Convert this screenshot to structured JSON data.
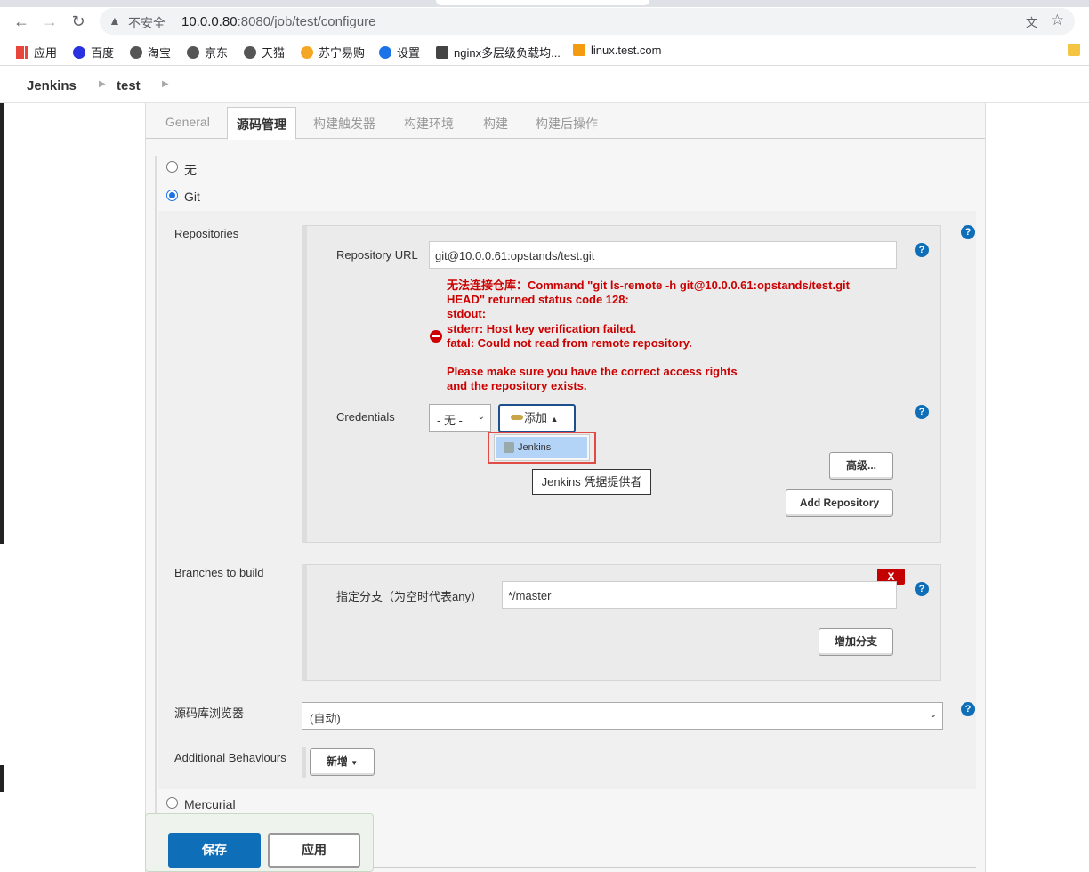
{
  "browser": {
    "back_icon": "arrow-left-icon",
    "forward_icon": "arrow-right-icon",
    "reload_icon": "reload-icon",
    "security_warning": "不安全",
    "url_host": "10.0.0.80",
    "url_path": ":8080/job/test/configure"
  },
  "bookmarks": [
    {
      "label": "应用",
      "icon": "apps-grid-icon"
    },
    {
      "label": "百度",
      "icon": "baidu-paw-icon"
    },
    {
      "label": "淘宝",
      "icon": "globe-icon"
    },
    {
      "label": "京东",
      "icon": "globe-icon"
    },
    {
      "label": "天猫",
      "icon": "globe-icon"
    },
    {
      "label": "苏宁易购",
      "icon": "suning-icon"
    },
    {
      "label": "设置",
      "icon": "gear-icon"
    },
    {
      "label": "nginx多层级负载均...",
      "icon": "nginx-icon"
    },
    {
      "label": "linux.test.com",
      "icon": "d-icon"
    }
  ],
  "breadcrumb": {
    "root": "Jenkins",
    "job": "test"
  },
  "tabs": [
    "General",
    "源码管理",
    "构建触发器",
    "构建环境",
    "构建",
    "构建后操作"
  ],
  "scm": {
    "option_none": "无",
    "option_git": "Git",
    "repositories_label": "Repositories",
    "repo_url_label": "Repository URL",
    "repo_url_value": "git@10.0.0.61:opstands/test.git",
    "error_lines": [
      "无法连接仓库：Command \"git ls-remote -h git@10.0.0.61:opstands/test.git",
      "HEAD\" returned status code 128:",
      "stdout:",
      "stderr: Host key verification failed.",
      "fatal: Could not read from remote repository.",
      "",
      "Please make sure you have the correct access rights",
      "and the repository exists."
    ],
    "credentials_label": "Credentials",
    "credentials_value": "- 无 -",
    "add_label": "添加",
    "dropdown_item": "Jenkins",
    "tooltip": "Jenkins 凭据提供者",
    "advanced_label": "高级...",
    "add_repo_label": "Add Repository",
    "branches_label": "Branches to build",
    "branch_spec_label": "指定分支（为空时代表any）",
    "branch_spec_value": "*/master",
    "delete_label": "X",
    "add_branch_label": "增加分支",
    "browser_label": "源码库浏览器",
    "browser_value": "(自动)",
    "behaviours_label": "Additional Behaviours",
    "new_label": "新增",
    "option_mercurial": "Mercurial"
  },
  "footer": {
    "save": "保存",
    "apply": "应用"
  },
  "colors": {
    "accent": "#0e6eb8",
    "error": "#cc0000",
    "highlight_border": "#e04b46"
  }
}
